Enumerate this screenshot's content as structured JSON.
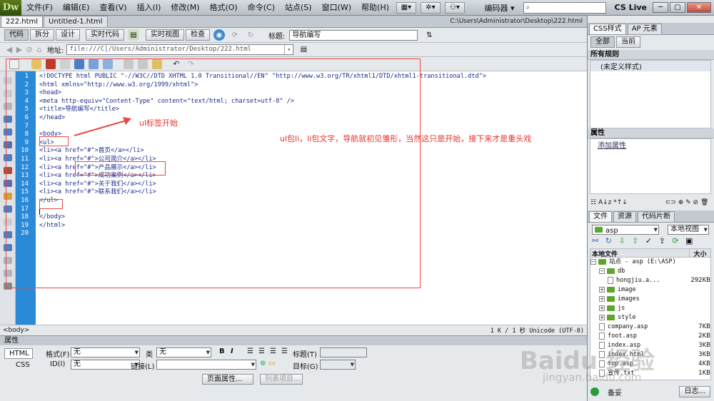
{
  "app": {
    "logo": "Dw"
  },
  "menu": [
    "文件(F)",
    "编辑(E)",
    "查看(V)",
    "插入(I)",
    "修改(M)",
    "格式(O)",
    "命令(C)",
    "站点(S)",
    "窗口(W)",
    "帮助(H)"
  ],
  "topbar": {
    "workspace": "编码器 ▾",
    "search_placeholder": "",
    "cslive": "CS Live"
  },
  "doc_tabs": [
    "222.html",
    "Untitled-1.html"
  ],
  "doc_path": "C:\\Users\\Administrator\\Desktop\\222.html",
  "view_buttons": [
    "代码",
    "拆分",
    "设计",
    "实时代码",
    "实时视图",
    "检查"
  ],
  "title_label": "标题:",
  "title_value": "导航编写",
  "address_label": "地址:",
  "address_value": "file:///C|/Users/Administrator/Desktop/222.html",
  "line_numbers": [
    "1",
    "2",
    "3",
    "4",
    "5",
    "6",
    "7",
    "8",
    "9",
    "10",
    "11",
    "12",
    "13",
    "14",
    "15",
    "16",
    "17",
    "18",
    "19",
    "20"
  ],
  "code_lines": [
    "<!DOCTYPE html PUBLIC \"-//W3C//DTD XHTML 1.0 Transitional//EN\" \"http://www.w3.org/TR/xhtml1/DTD/xhtml1-transitional.dtd\">",
    "<html xmlns=\"http://www.w3.org/1999/xhtml\">",
    "<head>",
    "<meta http-equiv=\"Content-Type\" content=\"text/html; charset=utf-8\" />",
    "<title>导航编写</title>",
    "</head>",
    "",
    "<body>",
    "<ul>",
    "<li><a href=\"#\">首页</a></li>",
    "<li><a href=\"#\">公司简介</a></li>",
    "<li><a href=\"#\">产品展示</a></li>",
    "<li><a href=\"#\">成功案例</a></li>",
    "<li><a href=\"#\">关于我们</a></li>",
    "<li><a href=\"#\">联系我们</a></li>",
    "</ul>",
    "",
    "</body>",
    "</html>",
    ""
  ],
  "annotations": {
    "ul_start": "ul标签开始",
    "description": "ul包li，li包文字，导航就初见雏形，当然这只是开始，接下来才是重头戏"
  },
  "status": {
    "tag": "<body>",
    "info": "1 K / 1 秒  Unicode (UTF-8)"
  },
  "properties": {
    "header": "属性",
    "html_btn": "HTML",
    "css_btn": "CSS",
    "format_label": "格式(F)",
    "format_value": "无",
    "class_label": "类",
    "class_value": "无",
    "id_label": "ID(I)",
    "id_value": "无",
    "link_label": "链接(L)",
    "link_value": "",
    "title_label": "标题(T)",
    "target_label": "目标(G)",
    "page_props_btn": "页面属性...",
    "list_item_btn": "列表项目..."
  },
  "right_panel": {
    "css_tabs": [
      "CSS样式",
      "AP 元素"
    ],
    "mode_buttons": [
      "全部",
      "当前"
    ],
    "all_rules": "所有规则",
    "undefined_style": "(未定义样式)",
    "properties": "属性",
    "add_property": "添加属性",
    "file_tabs": [
      "文件",
      "资源",
      "代码片断"
    ],
    "site_select": "asp",
    "view_select": "本地视图",
    "local_files": "本地文件",
    "size_col": "大小",
    "tree": [
      {
        "name": "站点 - asp (E:\\ASP)",
        "size": "",
        "depth": 0,
        "type": "site"
      },
      {
        "name": "db",
        "size": "",
        "depth": 1,
        "type": "folder"
      },
      {
        "name": "hongjiu.a...",
        "size": "292KB",
        "depth": 2,
        "type": "file"
      },
      {
        "name": "image",
        "size": "",
        "depth": 1,
        "type": "folder"
      },
      {
        "name": "images",
        "size": "",
        "depth": 1,
        "type": "folder"
      },
      {
        "name": "js",
        "size": "",
        "depth": 1,
        "type": "folder"
      },
      {
        "name": "style",
        "size": "",
        "depth": 1,
        "type": "folder"
      },
      {
        "name": "company.asp",
        "size": "7KB",
        "depth": 1,
        "type": "file"
      },
      {
        "name": "foot.asp",
        "size": "2KB",
        "depth": 1,
        "type": "file"
      },
      {
        "name": "index.asp",
        "size": "3KB",
        "depth": 1,
        "type": "file"
      },
      {
        "name": "index.html",
        "size": "3KB",
        "depth": 1,
        "type": "file"
      },
      {
        "name": "top.asp",
        "size": "4KB",
        "depth": 1,
        "type": "file"
      },
      {
        "name": "宣传.txt",
        "size": "1KB",
        "depth": 1,
        "type": "file"
      }
    ],
    "ready": "备妥",
    "log_btn": "日志..."
  },
  "watermark": {
    "main": "Baidu 经验",
    "sub": "jingyan.baidu.com"
  },
  "colors": {
    "line_gutter": "#2b8ad8",
    "annotation": "#e84848",
    "code_tag": "#1b2b8c"
  }
}
